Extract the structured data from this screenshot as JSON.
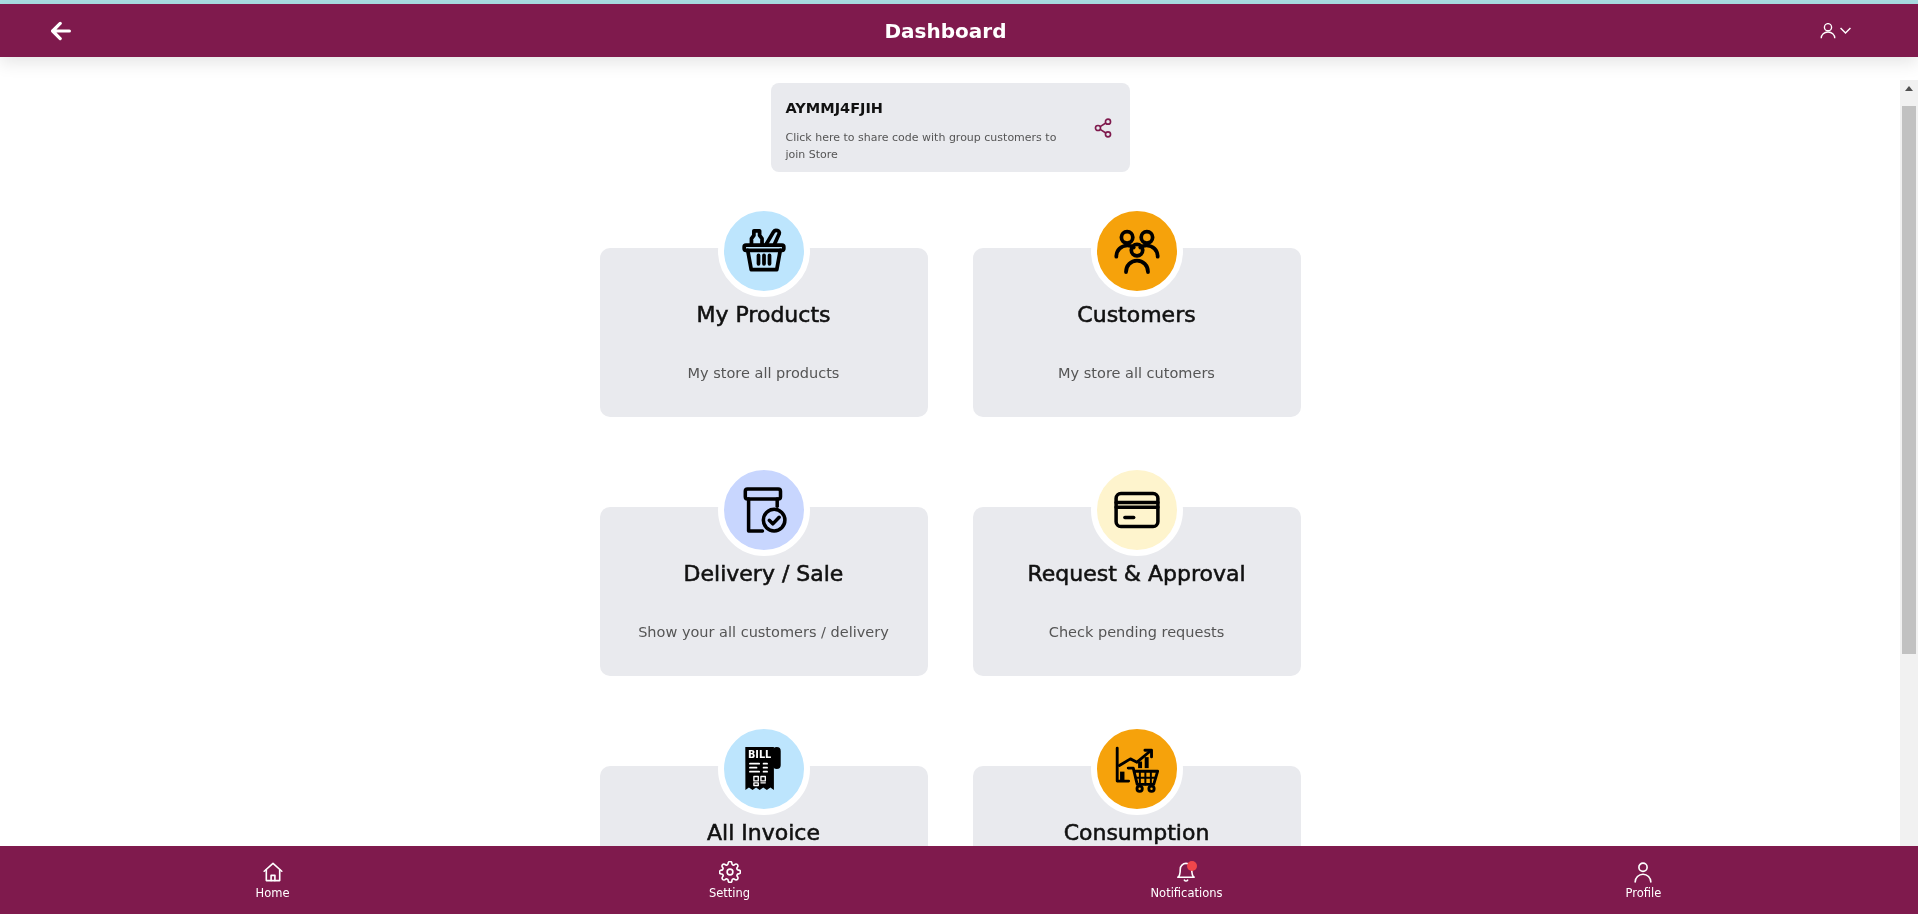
{
  "header": {
    "title": "Dashboard"
  },
  "share_card": {
    "code": "AYMMJ4FJIH",
    "description": "Click here to share code with group customers to join Store"
  },
  "tiles": [
    {
      "kind": "products",
      "color": "#bde5fd",
      "title": "My Products",
      "description": "My store all products"
    },
    {
      "kind": "customers",
      "color": "#f6a20b",
      "title": "Customers",
      "description": "My store all cutomers"
    },
    {
      "kind": "delivery",
      "color": "#c8d6fe",
      "title": "Delivery / Sale",
      "description": "Show your all customers / delivery"
    },
    {
      "kind": "requests",
      "color": "#fef4cd",
      "title": "Request & Approval",
      "description": "Check pending requests"
    },
    {
      "kind": "invoice",
      "color": "#bde5fd",
      "title": "All Invoice",
      "icon_text": "BILL"
    },
    {
      "kind": "consumption",
      "color": "#f6a20b",
      "title": "Consumption"
    }
  ],
  "bottom_nav": {
    "items": [
      {
        "kind": "home",
        "label": "Home",
        "alert": false
      },
      {
        "kind": "setting",
        "label": "Setting",
        "alert": false
      },
      {
        "kind": "notifications",
        "label": "Notifications",
        "alert": true
      },
      {
        "kind": "profile",
        "label": "Profile",
        "alert": false
      }
    ]
  }
}
